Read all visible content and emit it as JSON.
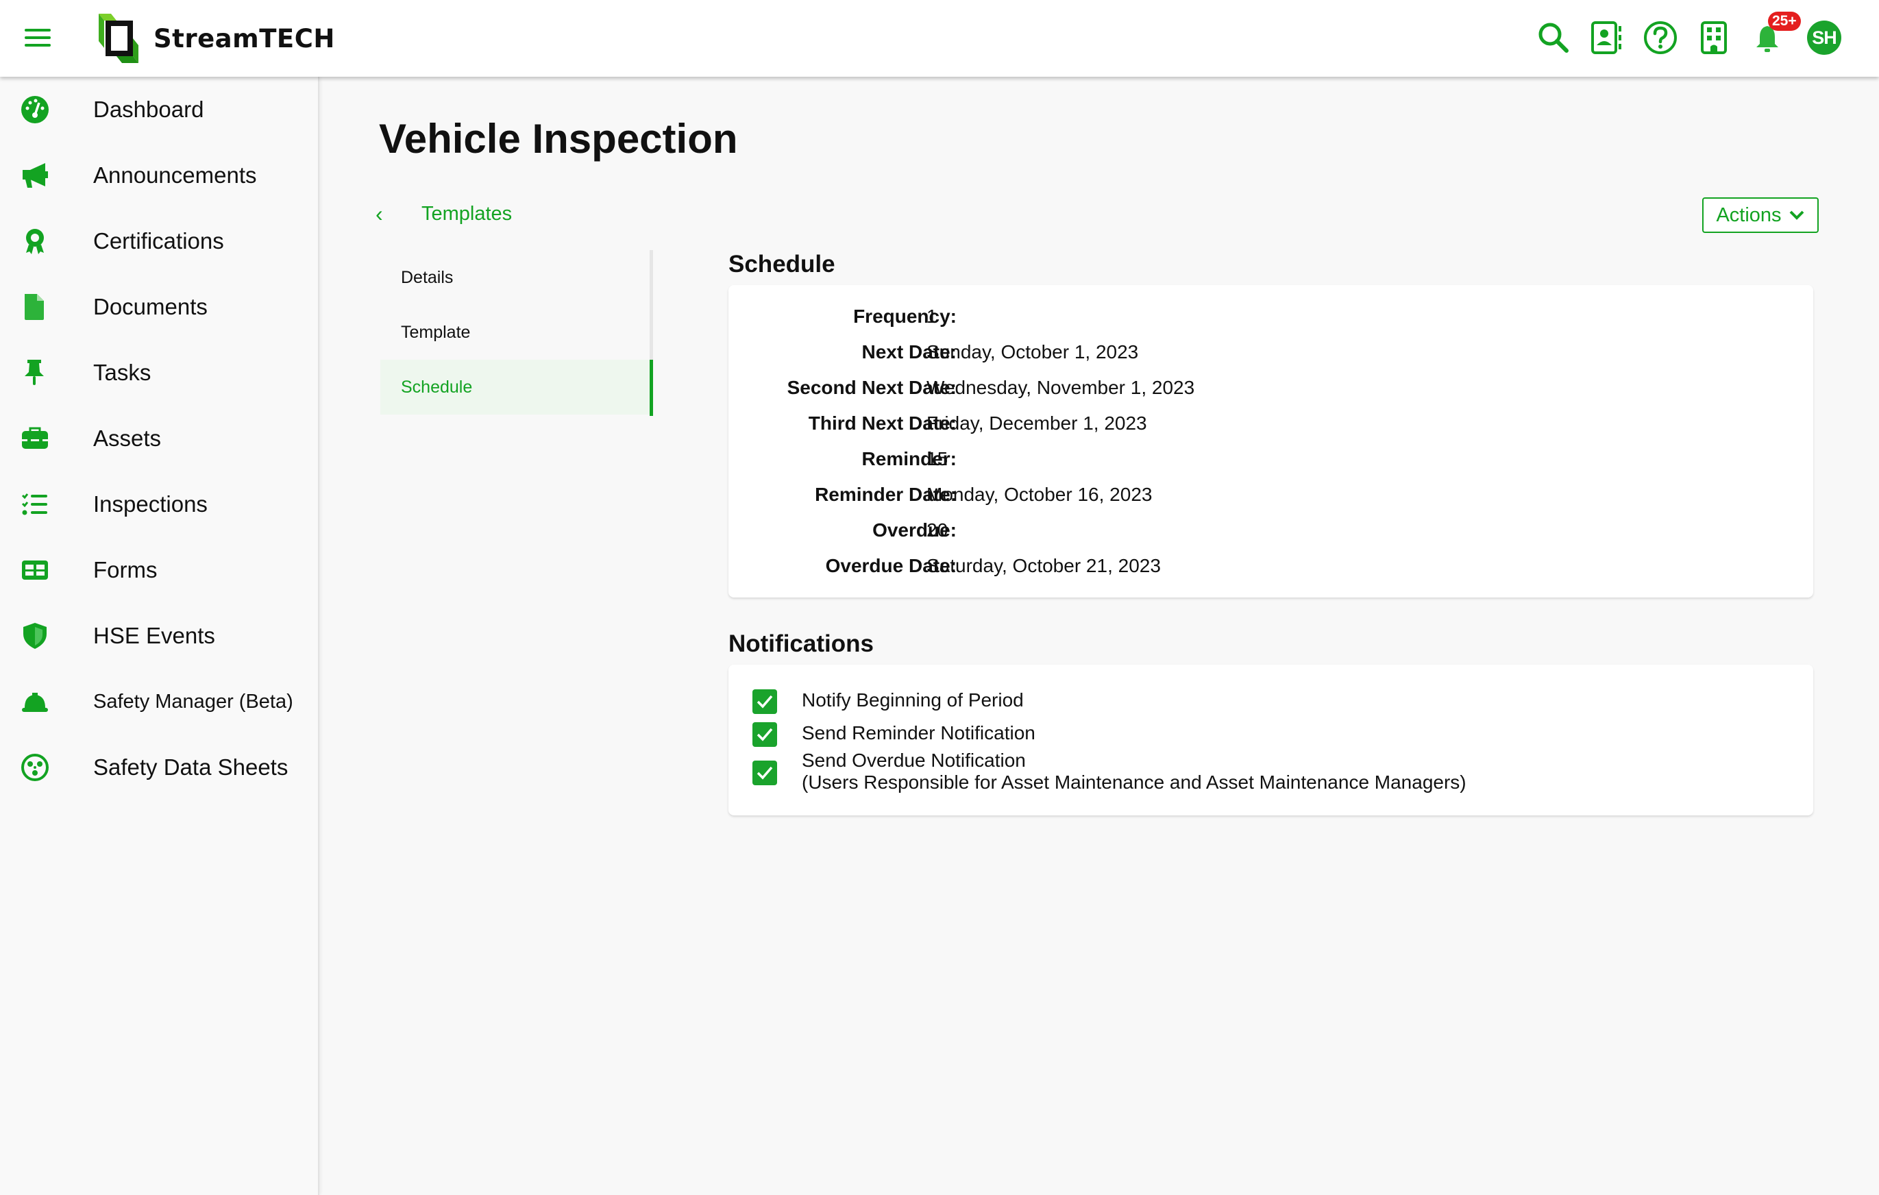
{
  "brand": {
    "name": "StreamTECH",
    "accent_color": "#13a322",
    "badge_color": "#e41e1e"
  },
  "header": {
    "icons": [
      "search-icon",
      "contacts-icon",
      "help-icon",
      "building-icon",
      "bell-icon"
    ],
    "notifications_badge": "25+",
    "avatar_initials": "SH"
  },
  "sidebar": {
    "items": [
      {
        "label": "Dashboard",
        "icon": "dashboard-icon"
      },
      {
        "label": "Announcements",
        "icon": "megaphone-icon"
      },
      {
        "label": "Certifications",
        "icon": "certificate-icon"
      },
      {
        "label": "Documents",
        "icon": "document-icon"
      },
      {
        "label": "Tasks",
        "icon": "pushpin-icon"
      },
      {
        "label": "Assets",
        "icon": "toolbox-icon"
      },
      {
        "label": "Inspections",
        "icon": "checklist-icon"
      },
      {
        "label": "Forms",
        "icon": "table-icon"
      },
      {
        "label": "HSE Events",
        "icon": "shield-icon"
      },
      {
        "label": "Safety Manager (Beta)",
        "icon": "hardhat-icon"
      },
      {
        "label": "Safety Data Sheets",
        "icon": "hazard-icon"
      }
    ]
  },
  "page": {
    "title": "Vehicle Inspection",
    "back_label": "Templates",
    "actions_label": "Actions",
    "subnav": [
      {
        "label": "Details",
        "active": false
      },
      {
        "label": "Template",
        "active": false
      },
      {
        "label": "Schedule",
        "active": true
      }
    ]
  },
  "schedule": {
    "title": "Schedule",
    "rows": [
      {
        "label": "Frequency:",
        "value": "1"
      },
      {
        "label": "Next Date:",
        "value": "Sunday, October 1, 2023"
      },
      {
        "label": "Second Next Date:",
        "value": "Wednesday, November 1, 2023"
      },
      {
        "label": "Third Next Date:",
        "value": "Friday, December 1, 2023"
      },
      {
        "label": "Reminder:",
        "value": "15"
      },
      {
        "label": "Reminder Date:",
        "value": "Monday, October 16, 2023"
      },
      {
        "label": "Overdue:",
        "value": "20"
      },
      {
        "label": "Overdue Date:",
        "value": "Saturday, October 21, 2023"
      }
    ]
  },
  "notifications": {
    "title": "Notifications",
    "items": [
      {
        "label": "Notify Beginning of Period",
        "checked": true
      },
      {
        "label": "Send Reminder Notification",
        "checked": true
      },
      {
        "label": "Send Overdue Notification",
        "sublabel": "(Users Responsible for Asset Maintenance and Asset Maintenance Managers)",
        "checked": true
      }
    ]
  }
}
